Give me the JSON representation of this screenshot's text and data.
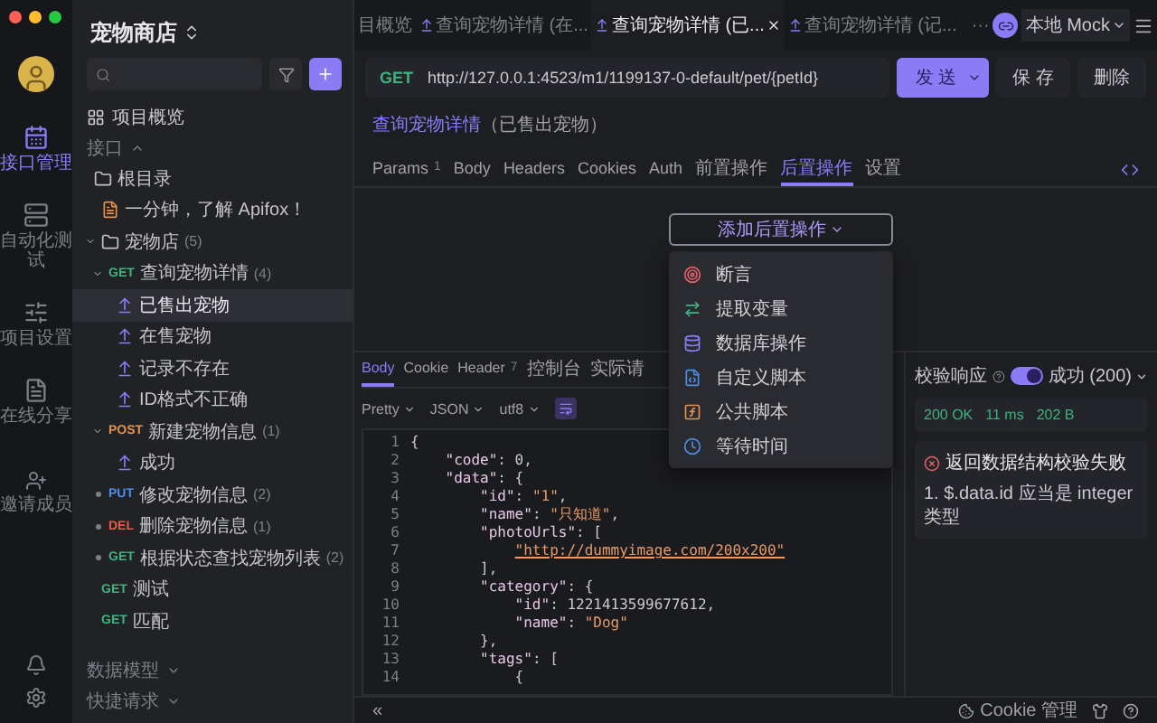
{
  "rail": {
    "items": [
      {
        "kind": "api",
        "label": "接口管理",
        "selected": true
      },
      {
        "kind": "test",
        "label": "自动化测试",
        "selected": false
      },
      {
        "kind": "settings",
        "label": "项目设置",
        "selected": false
      },
      {
        "kind": "share",
        "label": "在线分享",
        "selected": false
      }
    ],
    "invite": {
      "label": "邀请成员"
    }
  },
  "sidebar": {
    "title": "宠物商店",
    "overview": "项目概览",
    "section": "接口",
    "tree": [
      {
        "kind": "folder",
        "label": "根目录",
        "selected": false,
        "children": [
          {
            "kind": "doc",
            "label": "一分钟，了解 Apifox！",
            "selected": false
          },
          {
            "kind": "folder",
            "label": "宠物店",
            "count": "(5)",
            "expanded": true,
            "selected": false,
            "children": [
              {
                "kind": "api",
                "method": "GET",
                "color": "#3fb27f",
                "label": "查询宠物详情",
                "count": "(4)",
                "expanded": true,
                "selected": false,
                "children": [
                  {
                    "kind": "case",
                    "label": "已售出宠物",
                    "selected": true
                  },
                  {
                    "kind": "case",
                    "label": "在售宠物",
                    "selected": false
                  },
                  {
                    "kind": "case",
                    "label": "记录不存在",
                    "selected": false
                  },
                  {
                    "kind": "case",
                    "label": "ID格式不正确",
                    "selected": false
                  }
                ]
              },
              {
                "kind": "api",
                "method": "POST",
                "color": "#e8914a",
                "label": "新建宠物信息",
                "count": "(1)",
                "expanded": true,
                "selected": false,
                "children": [
                  {
                    "kind": "case",
                    "label": "成功",
                    "selected": false
                  }
                ]
              },
              {
                "kind": "api",
                "method": "PUT",
                "color": "#4a8fe8",
                "label": "修改宠物信息",
                "count": "(2)",
                "expanded": false,
                "selected": false
              },
              {
                "kind": "api",
                "method": "DEL",
                "color": "#e85a4a",
                "label": "删除宠物信息",
                "count": "(1)",
                "expanded": false,
                "selected": false
              },
              {
                "kind": "api",
                "method": "GET",
                "color": "#3fb27f",
                "label": "根据状态查找宠物列表",
                "count": "(2)",
                "expanded": false,
                "selected": false
              }
            ]
          },
          {
            "kind": "api",
            "method": "GET",
            "color": "#3fb27f",
            "label": "测试",
            "selected": false
          },
          {
            "kind": "api",
            "method": "GET",
            "color": "#3fb27f",
            "label": "匹配",
            "selected": false
          }
        ]
      }
    ],
    "footer": [
      "数据模型",
      "快捷请求"
    ]
  },
  "tabs": [
    {
      "kind": "overview",
      "label": "目概览",
      "selected": false
    },
    {
      "kind": "api",
      "label": "查询宠物详情 (在...",
      "selected": false
    },
    {
      "kind": "api",
      "label": "查询宠物详情 (已...",
      "selected": true
    },
    {
      "kind": "api",
      "label": "查询宠物详情 (记...",
      "selected": false
    }
  ],
  "tabs_overflow": "···",
  "environment": "本地 Mock",
  "request": {
    "method": "GET",
    "url": "http://127.0.0.1:4523/m1/1199137-0-default/pet/{petId}",
    "send": "发 送",
    "save": "保 存",
    "delete": "删除"
  },
  "breadcrumb": {
    "link": "查询宠物详情",
    "rest": "（已售出宠物）"
  },
  "request_tabs": [
    {
      "label": "Params",
      "badge": "1",
      "selected": false
    },
    {
      "label": "Body",
      "selected": false
    },
    {
      "label": "Headers",
      "selected": false
    },
    {
      "label": "Cookies",
      "selected": false
    },
    {
      "label": "Auth",
      "selected": false
    },
    {
      "label": "前置操作",
      "selected": false
    },
    {
      "label": "后置操作",
      "selected": true
    },
    {
      "label": "设置",
      "selected": false
    }
  ],
  "post_actions": {
    "button": "添加后置操作",
    "expanded": true,
    "items": [
      {
        "kind": "assert",
        "label": "断言"
      },
      {
        "kind": "extract",
        "label": "提取变量"
      },
      {
        "kind": "database",
        "label": "数据库操作"
      },
      {
        "kind": "script",
        "label": "自定义脚本"
      },
      {
        "kind": "public",
        "label": "公共脚本"
      },
      {
        "kind": "wait",
        "label": "等待时间"
      }
    ]
  },
  "response": {
    "tabs": [
      {
        "label": "Body",
        "selected": true
      },
      {
        "label": "Cookie",
        "selected": false
      },
      {
        "label": "Header",
        "badge": "7",
        "selected": false
      },
      {
        "label": "控制台",
        "selected": false
      },
      {
        "label": "实际请",
        "selected": false
      }
    ],
    "format": [
      "Pretty",
      "JSON",
      "utf8"
    ],
    "lines": [
      {
        "number": "1",
        "text": "{"
      },
      {
        "number": "2",
        "text": "    \"code\": 0,"
      },
      {
        "number": "3",
        "text": "    \"data\": {"
      },
      {
        "number": "4",
        "text": "        \"id\": \"1\","
      },
      {
        "number": "5",
        "text": "        \"name\": \"只知道\","
      },
      {
        "number": "6",
        "text": "        \"photoUrls\": ["
      },
      {
        "number": "7",
        "text": "            \"http://dummyimage.com/200x200\"",
        "link": true
      },
      {
        "number": "8",
        "text": "        ],"
      },
      {
        "number": "9",
        "text": "        \"category\": {"
      },
      {
        "number": "10",
        "text": "            \"id\": 1221413599677612,"
      },
      {
        "number": "11",
        "text": "            \"name\": \"Dog\""
      },
      {
        "number": "12",
        "text": "        },"
      },
      {
        "number": "13",
        "text": "        \"tags\": ["
      },
      {
        "number": "14",
        "text": "            {"
      }
    ]
  },
  "validation": {
    "label": "校验响应",
    "enabled": true,
    "result": "成功 (200)",
    "status": "200 OK",
    "time": "11 ms",
    "size": "202 B",
    "error_title": "返回数据结构校验失败",
    "error_detail": "1. $.data.id 应当是 integer 类型"
  },
  "status_bar": {
    "collapse": "«",
    "cookie": "Cookie 管理"
  }
}
